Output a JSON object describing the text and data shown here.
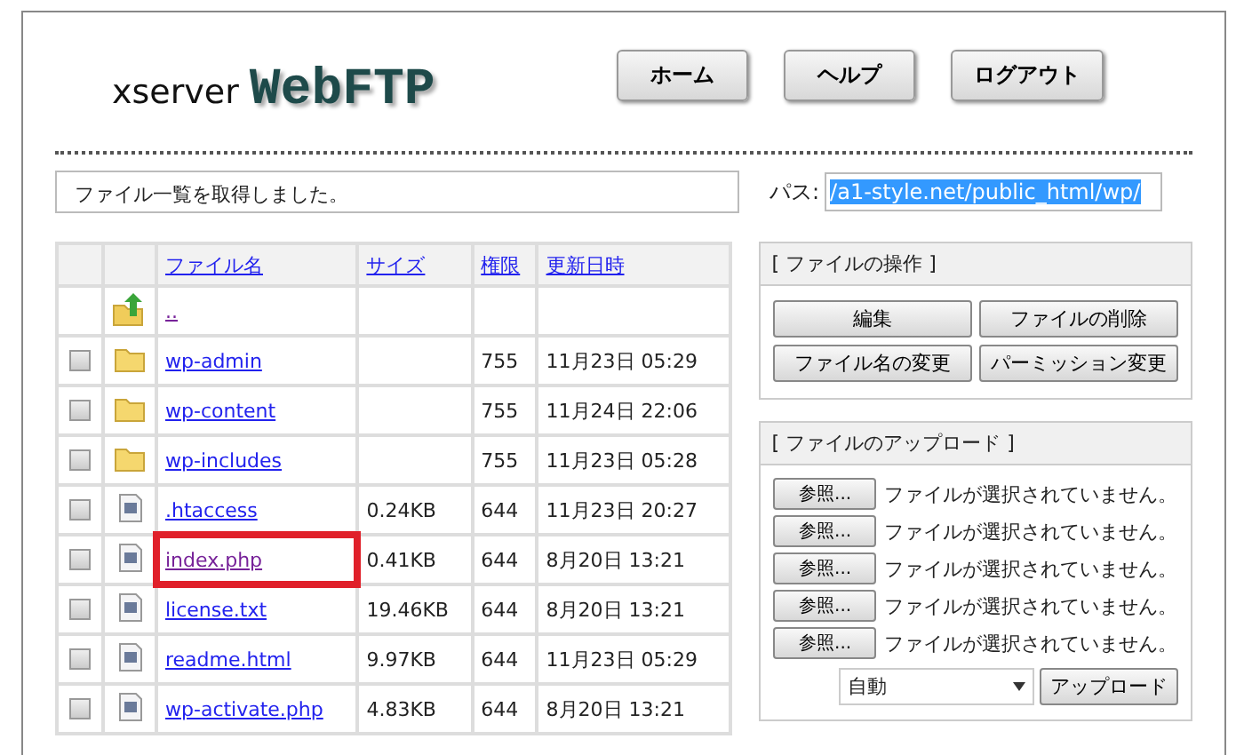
{
  "header": {
    "logo": {
      "prefix": "xserver",
      "name": "WebFTP"
    },
    "nav_buttons": [
      "ホーム",
      "ヘルプ",
      "ログアウト"
    ]
  },
  "status_message": "ファイル一覧を取得しました。",
  "path": {
    "label": "パス:",
    "value": "/a1-style.net/public_html/wp/",
    "selected": true
  },
  "table": {
    "columns": [
      "ファイル名",
      "サイズ",
      "権限",
      "更新日時"
    ],
    "rows": [
      {
        "kind": "parent",
        "name": "..",
        "visited": true,
        "highlighted": false
      },
      {
        "kind": "folder",
        "checked": false,
        "name": "wp-admin",
        "size": "",
        "permission": "755",
        "modified": "11月23日 05:29",
        "visited": false,
        "highlighted": false
      },
      {
        "kind": "folder",
        "checked": false,
        "name": "wp-content",
        "size": "",
        "permission": "755",
        "modified": "11月24日 22:06",
        "visited": false,
        "highlighted": false
      },
      {
        "kind": "folder",
        "checked": false,
        "name": "wp-includes",
        "size": "",
        "permission": "755",
        "modified": "11月23日 05:28",
        "visited": false,
        "highlighted": false
      },
      {
        "kind": "file",
        "checked": false,
        "name": ".htaccess",
        "size": "0.24KB",
        "permission": "644",
        "modified": "11月23日 20:27",
        "visited": false,
        "highlighted": false
      },
      {
        "kind": "file",
        "checked": false,
        "name": "index.php",
        "size": "0.41KB",
        "permission": "644",
        "modified": "8月20日 13:21",
        "visited": true,
        "highlighted": true
      },
      {
        "kind": "file",
        "checked": false,
        "name": "license.txt",
        "size": "19.46KB",
        "permission": "644",
        "modified": "8月20日 13:21",
        "visited": false,
        "highlighted": false
      },
      {
        "kind": "file",
        "checked": false,
        "name": "readme.html",
        "size": "9.97KB",
        "permission": "644",
        "modified": "11月23日 05:29",
        "visited": false,
        "highlighted": false
      },
      {
        "kind": "file",
        "checked": false,
        "name": "wp-activate.php",
        "size": "4.83KB",
        "permission": "644",
        "modified": "8月20日 13:21",
        "visited": false,
        "highlighted": false
      }
    ]
  },
  "file_operations": {
    "title": "[ ファイルの操作 ]",
    "buttons": [
      "編集",
      "ファイルの削除",
      "ファイル名の変更",
      "パーミッション変更"
    ]
  },
  "upload": {
    "title": "[ ファイルのアップロード ]",
    "inputs": [
      {
        "button": "参照...",
        "status": "ファイルが選択されていません。"
      },
      {
        "button": "参照...",
        "status": "ファイルが選択されていません。"
      },
      {
        "button": "参照...",
        "status": "ファイルが選択されていません。"
      },
      {
        "button": "参照...",
        "status": "ファイルが選択されていません。"
      },
      {
        "button": "参照...",
        "status": "ファイルが選択されていません。"
      }
    ],
    "mode": "自動",
    "submit": "アップロード"
  }
}
